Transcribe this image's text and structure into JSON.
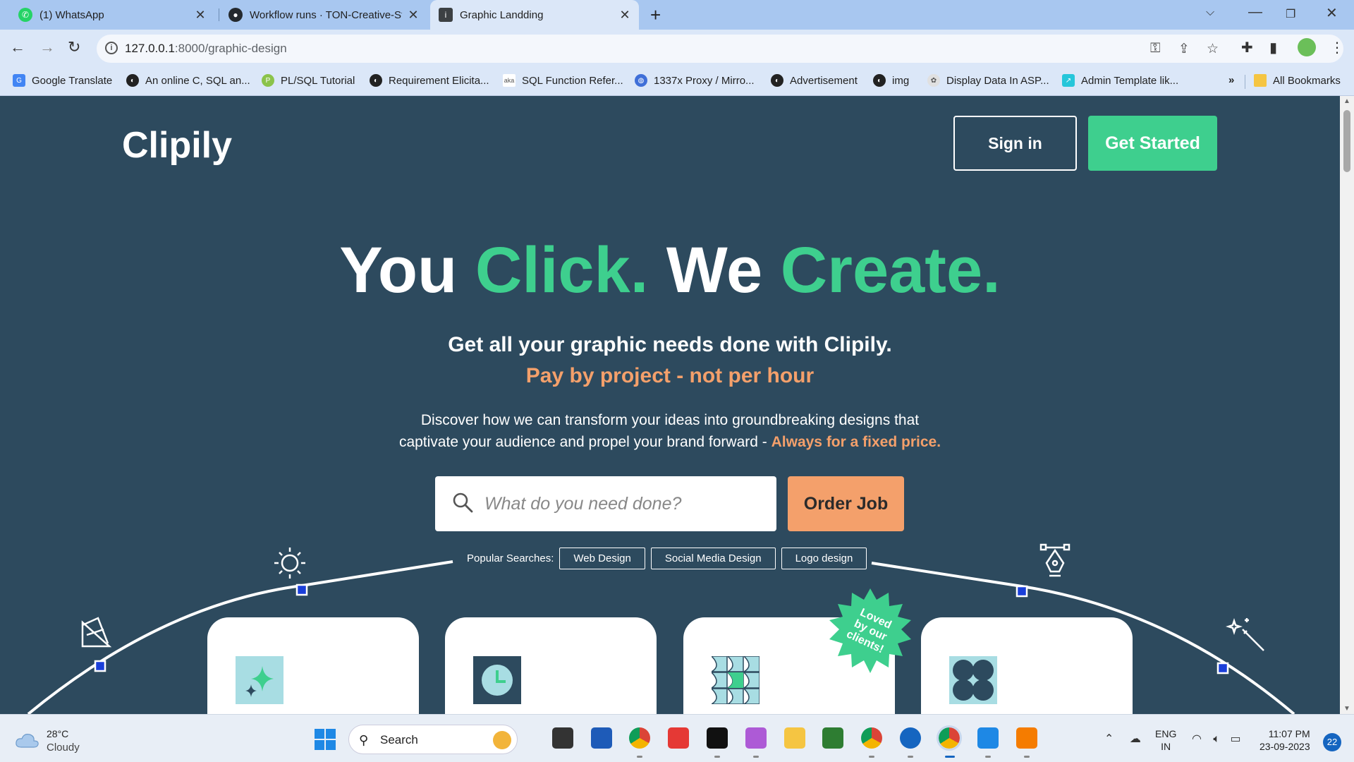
{
  "browser": {
    "tabs": [
      {
        "title": "(1) WhatsApp",
        "icon": "whatsapp-icon",
        "color": "#25d366"
      },
      {
        "title": "Workflow runs · TON-Creative-St",
        "icon": "github-icon",
        "color": "#24292e"
      },
      {
        "title": "Graphic Landding",
        "icon": "page-icon",
        "color": "#3c4043",
        "active": true
      }
    ],
    "url_host": "127.0.0.1",
    "url_path": ":8000/graphic-design",
    "bookmarks": [
      {
        "label": "Google Translate",
        "icon": "google-translate-icon",
        "color": "#4285f4"
      },
      {
        "label": "An online C, SQL an...",
        "icon": "globe-icon",
        "color": "#222"
      },
      {
        "label": "PL/SQL Tutorial",
        "icon": "plsql-icon",
        "color": "#8bc34a"
      },
      {
        "label": "Requirement Elicita...",
        "icon": "globe-icon",
        "color": "#222"
      },
      {
        "label": "SQL Function Refer...",
        "icon": "aka-icon",
        "color": "#555"
      },
      {
        "label": "1337x Proxy / Mirro...",
        "icon": "globe-icon",
        "color": "#3f6fd8"
      },
      {
        "label": "Advertisement",
        "icon": "globe-icon",
        "color": "#222"
      },
      {
        "label": "img",
        "icon": "globe-icon",
        "color": "#222"
      },
      {
        "label": "Display Data In ASP...",
        "icon": "asp-icon",
        "color": "#e0e0e0"
      },
      {
        "label": "Admin Template lik...",
        "icon": "admin-icon",
        "color": "#26c6da"
      }
    ],
    "more_bookmarks": "»",
    "all_bookmarks": "All Bookmarks"
  },
  "site": {
    "logo": "Clipily",
    "nav": {
      "signin": "Sign in",
      "get_started": "Get Started"
    },
    "hero": {
      "w1": "You ",
      "w2": "Click.",
      "w3": " We ",
      "w4": "Create.",
      "subhead": "Get all your graphic needs done with Clipily.",
      "payline": "Pay by project - not per hour",
      "desc_line1": "Discover how we can transform your ideas into groundbreaking designs that",
      "desc_line2": "captivate your audience and propel your brand forward - ",
      "desc_highlight": "Always for a fixed price."
    },
    "search": {
      "placeholder": "What do you need done?",
      "button": "Order Job"
    },
    "popular": {
      "label": "Popular Searches:",
      "items": [
        "Web Design",
        "Social Media Design",
        "Logo design"
      ]
    },
    "badge": {
      "line1": "Loved",
      "line2": "by our",
      "line3": "clients!"
    },
    "colors": {
      "bg": "#2d4a5e",
      "green": "#3ecf8e",
      "orange": "#f4a06b",
      "card_icon_bg": "#a8dde3"
    }
  },
  "taskbar": {
    "weather_temp": "28°C",
    "weather_desc": "Cloudy",
    "search": "Search",
    "lang1": "ENG",
    "lang2": "IN",
    "time": "11:07 PM",
    "date": "23-09-2023",
    "notifications": "22"
  }
}
